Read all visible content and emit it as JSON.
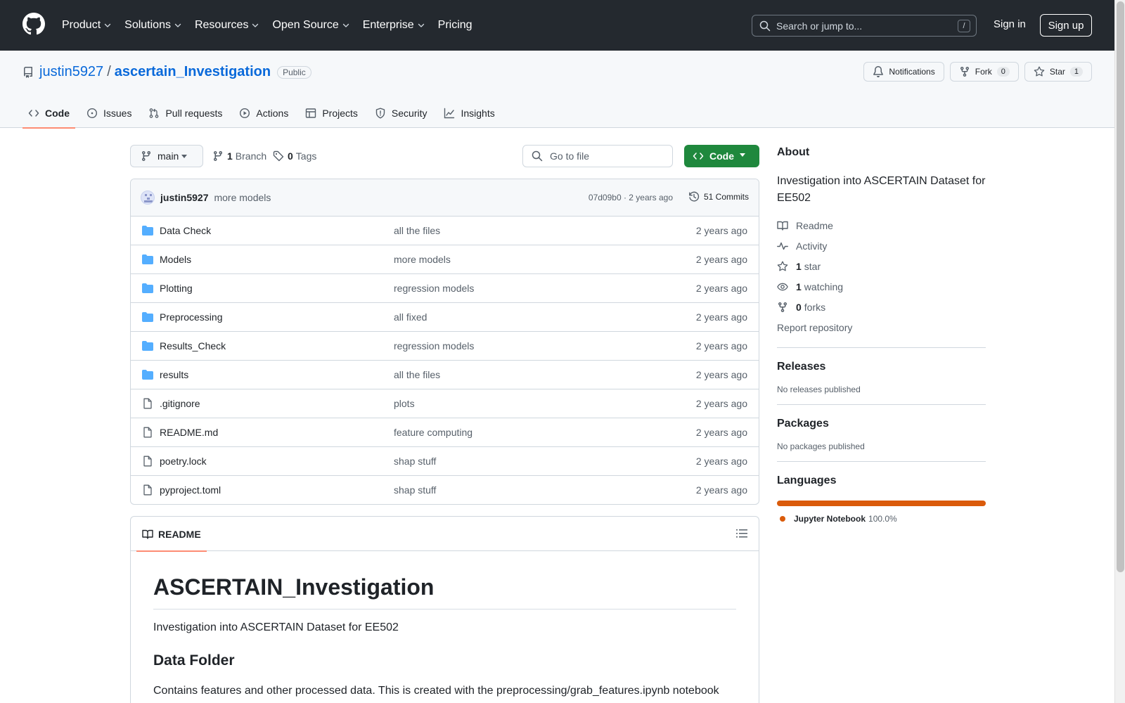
{
  "topbar": {
    "nav": [
      {
        "label": "Product",
        "has_menu": true
      },
      {
        "label": "Solutions",
        "has_menu": true
      },
      {
        "label": "Resources",
        "has_menu": true
      },
      {
        "label": "Open Source",
        "has_menu": true
      },
      {
        "label": "Enterprise",
        "has_menu": true
      },
      {
        "label": "Pricing",
        "has_menu": false
      }
    ],
    "search_placeholder": "Search or jump to...",
    "search_shortcut": "/",
    "sign_in": "Sign in",
    "sign_up": "Sign up"
  },
  "repo": {
    "owner": "justin5927",
    "separator": "/",
    "name": "ascertain_Investigation",
    "visibility": "Public",
    "notifications_label": "Notifications",
    "fork_label": "Fork",
    "fork_count": "0",
    "star_label": "Star",
    "star_count": "1",
    "tabs": [
      {
        "label": "Code",
        "icon": "code-icon",
        "active": true
      },
      {
        "label": "Issues",
        "icon": "issue-icon",
        "active": false
      },
      {
        "label": "Pull requests",
        "icon": "pull-request-icon",
        "active": false
      },
      {
        "label": "Actions",
        "icon": "play-icon",
        "active": false
      },
      {
        "label": "Projects",
        "icon": "table-icon",
        "active": false
      },
      {
        "label": "Security",
        "icon": "shield-icon",
        "active": false
      },
      {
        "label": "Insights",
        "icon": "graph-icon",
        "active": false
      }
    ]
  },
  "filenav": {
    "branch": "main",
    "branch_count": "1",
    "branch_label": "Branch",
    "tag_count": "0",
    "tag_label": "Tags",
    "goto_placeholder": "Go to file",
    "code_button": "Code"
  },
  "commit": {
    "author": "justin5927",
    "message": "more models",
    "sha_and_time": "07d09b0 · 2 years ago",
    "commits_label": "51 Commits"
  },
  "files": [
    {
      "type": "folder",
      "name": "Data Check",
      "commit": "all the files",
      "age": "2 years ago"
    },
    {
      "type": "folder",
      "name": "Models",
      "commit": "more models",
      "age": "2 years ago"
    },
    {
      "type": "folder",
      "name": "Plotting",
      "commit": "regression models",
      "age": "2 years ago"
    },
    {
      "type": "folder",
      "name": "Preprocessing",
      "commit": "all fixed",
      "age": "2 years ago"
    },
    {
      "type": "folder",
      "name": "Results_Check",
      "commit": "regression models",
      "age": "2 years ago"
    },
    {
      "type": "folder",
      "name": "results",
      "commit": "all the files",
      "age": "2 years ago"
    },
    {
      "type": "file",
      "name": ".gitignore",
      "commit": "plots",
      "age": "2 years ago"
    },
    {
      "type": "file",
      "name": "README.md",
      "commit": "feature computing",
      "age": "2 years ago"
    },
    {
      "type": "file",
      "name": "poetry.lock",
      "commit": "shap stuff",
      "age": "2 years ago"
    },
    {
      "type": "file",
      "name": "pyproject.toml",
      "commit": "shap stuff",
      "age": "2 years ago"
    }
  ],
  "readme": {
    "tab_label": "README",
    "h1": "ASCERTAIN_Investigation",
    "intro": "Investigation into ASCERTAIN Dataset for EE502",
    "h2": "Data Folder",
    "data_folder_text": "Contains features and other processed data. This is created with the preprocessing/grab_features.ipynb notebook"
  },
  "sidebar": {
    "about_heading": "About",
    "about_description": "Investigation into ASCERTAIN Dataset for EE502",
    "items": [
      {
        "icon": "book-icon",
        "count": "",
        "label": "Readme"
      },
      {
        "icon": "pulse-icon",
        "count": "",
        "label": "Activity"
      },
      {
        "icon": "star-icon",
        "count": "1",
        "label": "star"
      },
      {
        "icon": "eye-icon",
        "count": "1",
        "label": "watching"
      },
      {
        "icon": "fork-icon",
        "count": "0",
        "label": "forks"
      }
    ],
    "report": "Report repository",
    "releases_heading": "Releases",
    "releases_empty": "No releases published",
    "packages_heading": "Packages",
    "packages_empty": "No packages published",
    "languages_heading": "Languages",
    "languages": [
      {
        "name": "Jupyter Notebook",
        "percent": "100.0%",
        "color": "#DA5B0B"
      }
    ]
  },
  "colors": {
    "header_bg": "#24292f",
    "link": "#0969da",
    "primary_green": "#1f883d",
    "active_tab_underline": "#fd8c73",
    "folder_icon": "#54aeff"
  }
}
